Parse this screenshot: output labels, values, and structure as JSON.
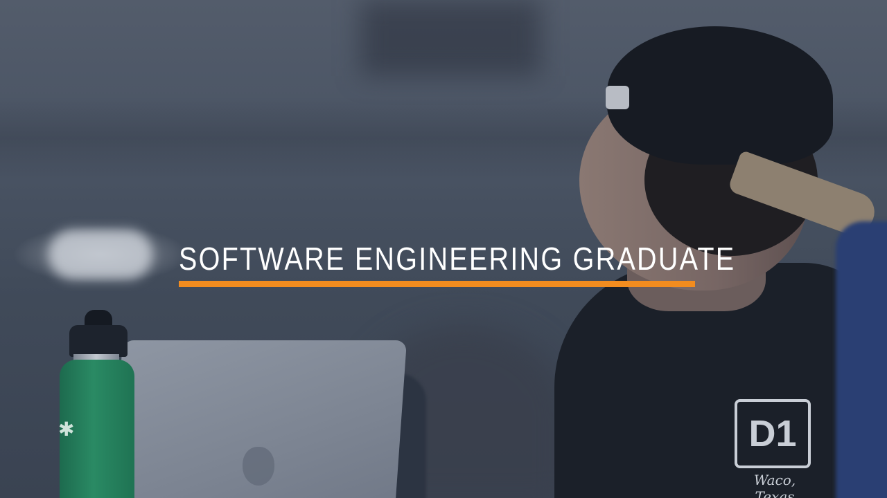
{
  "overlay": {
    "title": "SOFTWARE ENGINEERING GRADUATE",
    "accent_color": "#f28c1f",
    "text_color": "#ffffff"
  },
  "shirt": {
    "logo_text": "D1",
    "caption": "Waco, Texas"
  },
  "scene": {
    "tint_color": "#3f4a5a",
    "bottle_color": "#2a8a64"
  }
}
